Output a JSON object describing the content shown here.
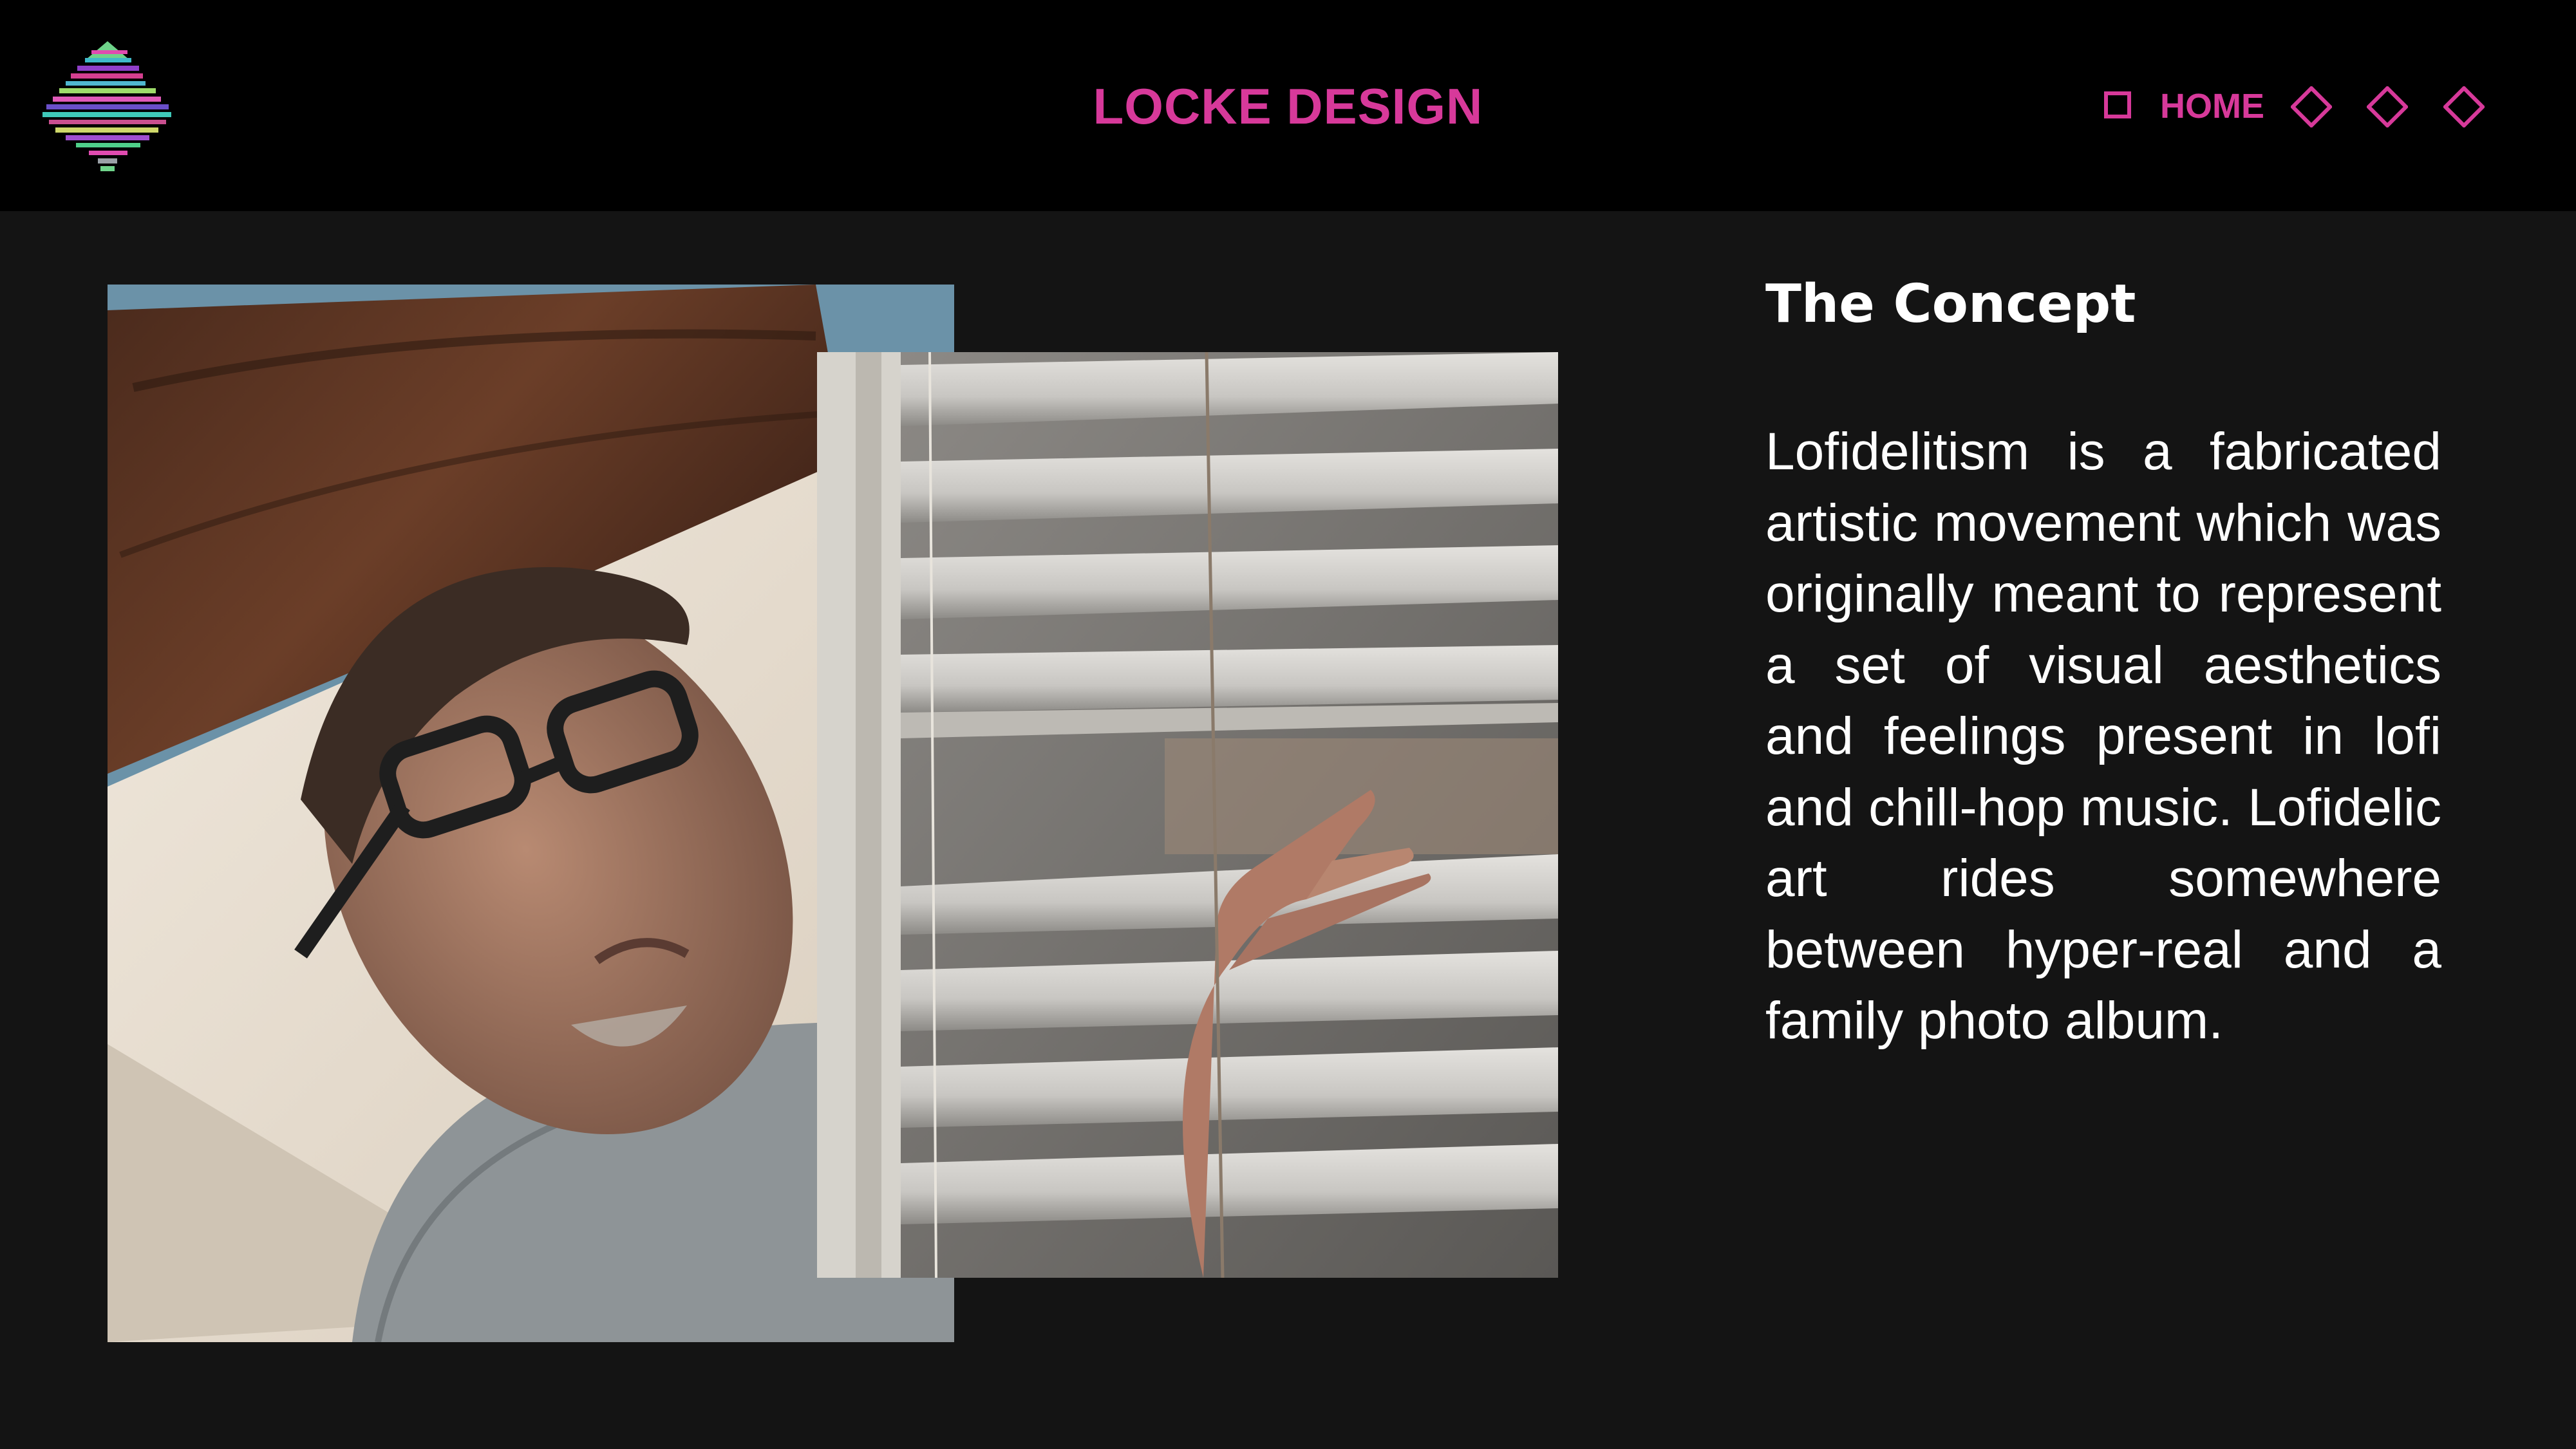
{
  "header": {
    "brand": "LOCKE DESIGN",
    "nav": {
      "home_label": "HOME"
    }
  },
  "colors": {
    "accent": "#d7399a",
    "header_bg": "#000000",
    "page_bg": "#141414",
    "text": "#ffffff"
  },
  "icons": {
    "logo": "glitch-tree-logo",
    "nav_current": "square-icon",
    "nav_items": [
      "diamond-icon",
      "diamond-icon",
      "diamond-icon"
    ]
  },
  "content": {
    "title": "The Concept",
    "body": "Lofidelitism is a fabricated artistic movement which was originally meant to rep­resent a set of visual aes­thetics and feelings present in lofi and chill-hop music. Lofidelic art rides some­where between hyper-real and a family photo album."
  }
}
